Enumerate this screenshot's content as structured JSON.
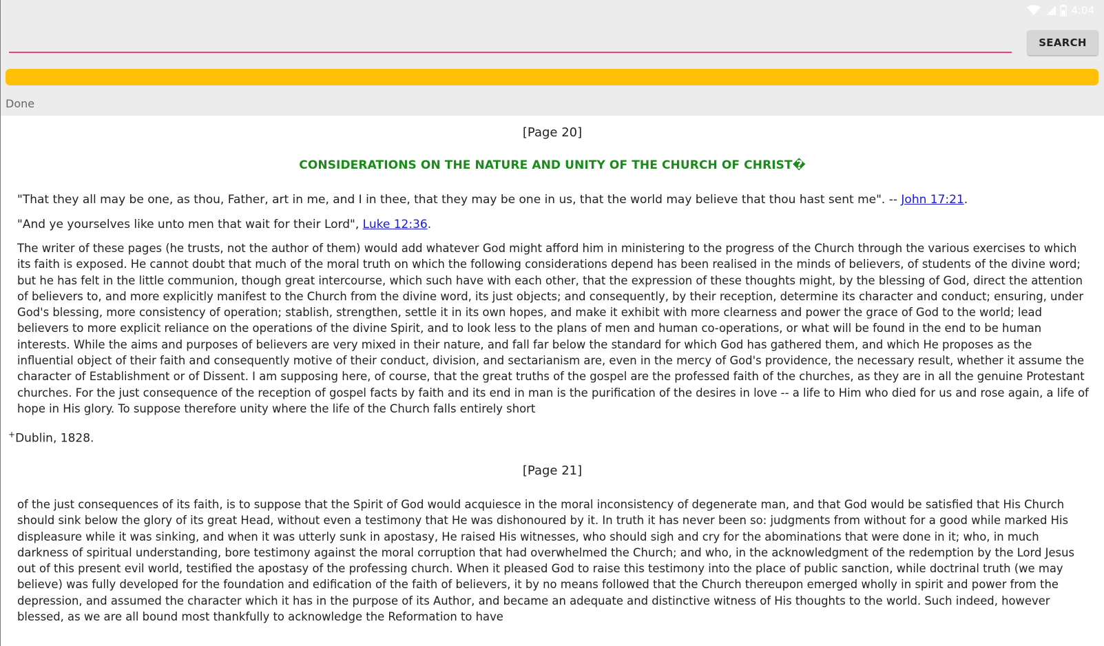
{
  "statusbar": {
    "time": "4:04",
    "icons": [
      "wifi-icon",
      "signal-icon",
      "battery-icon"
    ]
  },
  "toolbar": {
    "url_value": "",
    "url_placeholder": "",
    "search_label": "SEARCH"
  },
  "progress": {
    "percent": 100,
    "color": "#ffc107"
  },
  "status": {
    "text": "Done"
  },
  "colors": {
    "accent_underline": "#e8407a",
    "title_green": "#1a8a1a",
    "link_blue": "#1a1ad6"
  },
  "content": {
    "page1_marker": "[Page 20]",
    "title": "CONSIDERATIONS ON THE NATURE AND UNITY OF THE CHURCH OF CHRIST�",
    "quote1": {
      "text": "\"That they all may be one, as thou, Father, art in me, and I in thee, that they may be one in us, that the world may believe that thou hast sent me\". -- ",
      "link": "John 17:21",
      "after": "."
    },
    "quote2": {
      "text": "\"And ye yourselves like unto men that wait for their Lord\", ",
      "link": "Luke 12:36",
      "after": "."
    },
    "paragraph1": "The writer of these pages (he trusts, not the author of them) would add whatever God might afford him in ministering to the progress of the Church through the various exercises to which its faith is exposed. He cannot doubt that much of the moral truth on which the following considerations depend has been realised in the minds of believers, of students of the divine word; but he has felt in the little communion, though great intercourse, which such have with each other, that the expression of these thoughts might, by the blessing of God, direct the attention of believers to, and more explicitly manifest to the Church from the divine word, its just objects; and consequently, by their reception, determine its character and conduct; ensuring, under God's blessing, more consistency of operation; stablish, strengthen, settle it in its own hopes, and make it exhibit with more clearness and power the grace of God to the world; lead believers to more explicit reliance on the operations of the divine Spirit, and to look less to the plans of men and human co-operations, or what will be found in the end to be human interests. While the aims and purposes of believers are very mixed in their nature, and fall far below the standard for which God has gathered them, and which He proposes as the influential object of their faith and consequently motive of their conduct, division, and sectarianism are, even in the mercy of God's providence, the necessary result, whether it assume the character of Establishment or of Dissent. I am supposing here, of course, that the great truths of the gospel are the professed faith of the churches, as they are in all the genuine Protestant churches. For the just consequence of the reception of gospel facts by faith and its end in man is the purification of the desires in love -- a life to Him who died for us and rose again, a life of hope in His glory. To suppose therefore unity where the life of the Church falls entirely short",
    "footnote_mark": "+",
    "footnote": "Dublin, 1828.",
    "page2_marker": "[Page 21]",
    "paragraph2": "of the just consequences of its faith, is to suppose that the Spirit of God would acquiesce in the moral inconsistency of degenerate man, and that God would be satisfied that His Church should sink below the glory of its great Head, without even a testimony that He was dishonoured by it. In truth it has never been so: judgments from without for a good while marked His displeasure while it was sinking, and when it was utterly sunk in apostasy, He raised His witnesses, who should sigh and cry for the abominations that were done in it; who, in much darkness of spiritual understanding, bore testimony against the moral corruption that had overwhelmed the Church; and who, in the acknowledgment of the redemption by the Lord Jesus out of this present evil world, testified the apostasy of the professing church. When it pleased God to raise this testimony into the place of public sanction, while doctrinal truth (we may believe) was fully developed for the foundation and edification of the faith of believers, it by no means followed that the Church thereupon emerged wholly in spirit and power from the depression, and assumed the character which it has in the purpose of its Author, and became an adequate and distinctive witness of His thoughts to the world. Such indeed, however blessed, as we are all bound most thankfully to acknowledge the Reformation to have"
  }
}
